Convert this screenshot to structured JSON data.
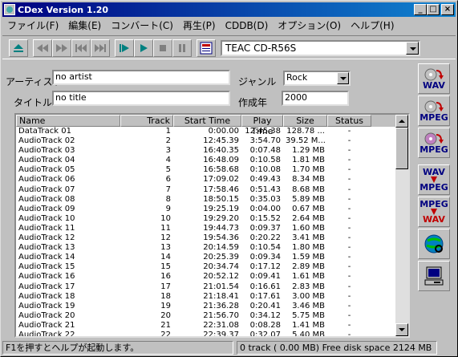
{
  "window": {
    "title": "CDex Version 1.20"
  },
  "menu": [
    "ファイル(F)",
    "編集(E)",
    "コンバート(C)",
    "再生(P)",
    "CDDB(D)",
    "オプション(O)",
    "ヘルプ(H)"
  ],
  "drive": {
    "selected": "TEAC    CD-R56S"
  },
  "form": {
    "artist_label": "アーティスト",
    "artist_value": "no artist",
    "title_label": "タイトル",
    "title_value": "no title",
    "genre_label": "ジャンル",
    "genre_value": "Rock",
    "year_label": "作成年",
    "year_value": "2000"
  },
  "table": {
    "headers": [
      "Name",
      "Track",
      "Start Time",
      "Play Time",
      "Size",
      "Status"
    ],
    "rows": [
      [
        "DataTrack 01",
        "1",
        "0:00.00",
        "12:45.38",
        "128.78 ...",
        "-"
      ],
      [
        "AudioTrack 02",
        "2",
        "12:45.39",
        "3:54.70",
        "39.52 M...",
        "-"
      ],
      [
        "AudioTrack 03",
        "3",
        "16:40.35",
        "0:07.48",
        "1.29 MB",
        "-"
      ],
      [
        "AudioTrack 04",
        "4",
        "16:48.09",
        "0:10.58",
        "1.81 MB",
        "-"
      ],
      [
        "AudioTrack 05",
        "5",
        "16:58.68",
        "0:10.08",
        "1.70 MB",
        "-"
      ],
      [
        "AudioTrack 06",
        "6",
        "17:09.02",
        "0:49.43",
        "8.34 MB",
        "-"
      ],
      [
        "AudioTrack 07",
        "7",
        "17:58.46",
        "0:51.43",
        "8.68 MB",
        "-"
      ],
      [
        "AudioTrack 08",
        "8",
        "18:50.15",
        "0:35.03",
        "5.89 MB",
        "-"
      ],
      [
        "AudioTrack 09",
        "9",
        "19:25.19",
        "0:04.00",
        "0.67 MB",
        "-"
      ],
      [
        "AudioTrack 10",
        "10",
        "19:29.20",
        "0:15.52",
        "2.64 MB",
        "-"
      ],
      [
        "AudioTrack 11",
        "11",
        "19:44.73",
        "0:09.37",
        "1.60 MB",
        "-"
      ],
      [
        "AudioTrack 12",
        "12",
        "19:54.36",
        "0:20.22",
        "3.41 MB",
        "-"
      ],
      [
        "AudioTrack 13",
        "13",
        "20:14.59",
        "0:10.54",
        "1.80 MB",
        "-"
      ],
      [
        "AudioTrack 14",
        "14",
        "20:25.39",
        "0:09.34",
        "1.59 MB",
        "-"
      ],
      [
        "AudioTrack 15",
        "15",
        "20:34.74",
        "0:17.12",
        "2.89 MB",
        "-"
      ],
      [
        "AudioTrack 16",
        "16",
        "20:52.12",
        "0:09.41",
        "1.61 MB",
        "-"
      ],
      [
        "AudioTrack 17",
        "17",
        "21:01.54",
        "0:16.61",
        "2.83 MB",
        "-"
      ],
      [
        "AudioTrack 18",
        "18",
        "21:18.41",
        "0:17.61",
        "3.00 MB",
        "-"
      ],
      [
        "AudioTrack 19",
        "19",
        "21:36.28",
        "0:20.41",
        "3.46 MB",
        "-"
      ],
      [
        "AudioTrack 20",
        "20",
        "21:56.70",
        "0:34.12",
        "5.75 MB",
        "-"
      ],
      [
        "AudioTrack 21",
        "21",
        "22:31.08",
        "0:08.28",
        "1.41 MB",
        "-"
      ],
      [
        "AudioTrack 22",
        "22",
        "22:39.37",
        "0:32.07",
        "5.40 MB",
        "-"
      ]
    ]
  },
  "side_buttons": [
    {
      "icon": "cd-to-wav-icon",
      "label": "WAV"
    },
    {
      "icon": "cd-to-mpeg-icon",
      "label": "MPEG"
    },
    {
      "icon": "cd-to-mpeg2-icon",
      "label": "MPEG"
    },
    {
      "icon": "wav-to-mpeg-icon",
      "label_top": "WAV",
      "label_bottom": "MPEG"
    },
    {
      "icon": "mpeg-to-wav-icon",
      "label_top": "MPEG",
      "label_bottom": "WAV"
    },
    {
      "icon": "globe-search-icon"
    },
    {
      "icon": "computer-icon"
    }
  ],
  "status": {
    "help": "F1を押すとヘルプが起動します。",
    "info": "0 track  ( 0.00 MB) Free disk space   2124 MB"
  }
}
